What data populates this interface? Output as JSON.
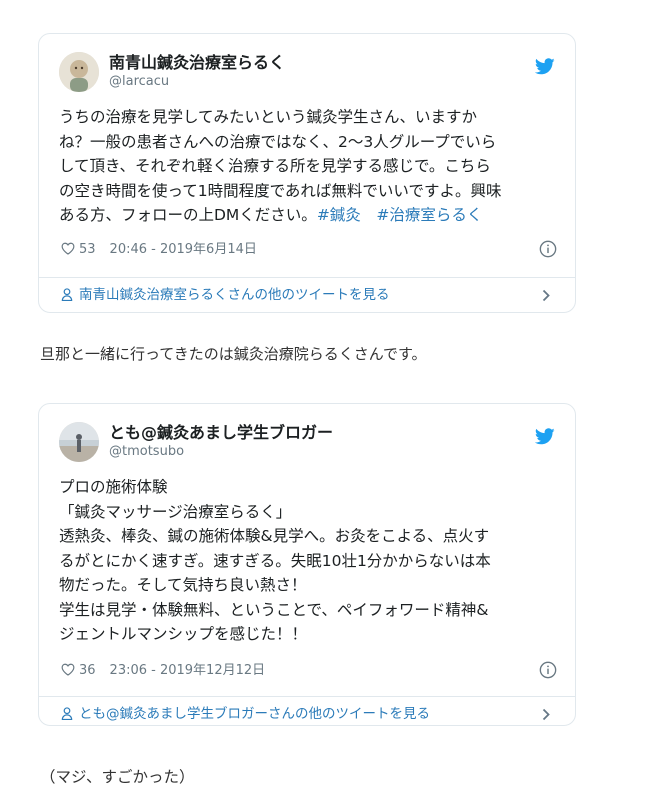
{
  "tweets": [
    {
      "display_name": "南青山鍼灸治療室らるく",
      "handle": "@larcacu",
      "body_text": "うちの治療を見学してみたいという鍼灸学生さん、いますか\nね？一般の患者さんへの治療ではなく、2〜3人グループでいら\nして頂き、それぞれ軽く治療する所を見学する感じで。こちら\nの空き時間を使って1時間程度であれば無料でいいですよ。興味\nある方、フォローの上DMください。",
      "hashtags": [
        "#鍼灸",
        "#治療室らるく"
      ],
      "likes": "53",
      "timestamp": "20:46 - 2019年6月14日",
      "more_link": "南青山鍼灸治療室らるくさんの他のツイートを見る"
    },
    {
      "display_name": "とも@鍼灸あまし学生ブロガー",
      "handle": "@tmotsubo",
      "body_text": "プロの施術体験\n「鍼灸マッサージ治療室らるく」\n透熱灸、棒灸、鍼の施術体験&見学へ。お灸をこよる、点火す\nるがとにかく速すぎ。速すぎる。失眠10壮1分かからないは本\n物だった。そして気持ち良い熱さ！\n学生は見学・体験無料、ということで、ペイフォワード精神&\nジェントルマンシップを感じた！！",
      "likes": "36",
      "timestamp": "23:06 - 2019年12月12日",
      "more_link": "とも@鍼灸あまし学生ブロガーさんの他のツイートを見る"
    }
  ],
  "paragraphs": {
    "after_first": "旦那と一緒に行ってきたのは鍼灸治療院らるくさんです。",
    "closing": "（マジ、すごかった）"
  },
  "icons": {
    "bird": "twitter-bird-icon",
    "heart": "heart-icon",
    "info": "info-icon",
    "person": "person-icon",
    "chevron": "chevron-right-icon"
  },
  "colors": {
    "link": "#2b7bb9",
    "twitter_blue": "#1da1f2",
    "meta_gray": "#697882"
  }
}
